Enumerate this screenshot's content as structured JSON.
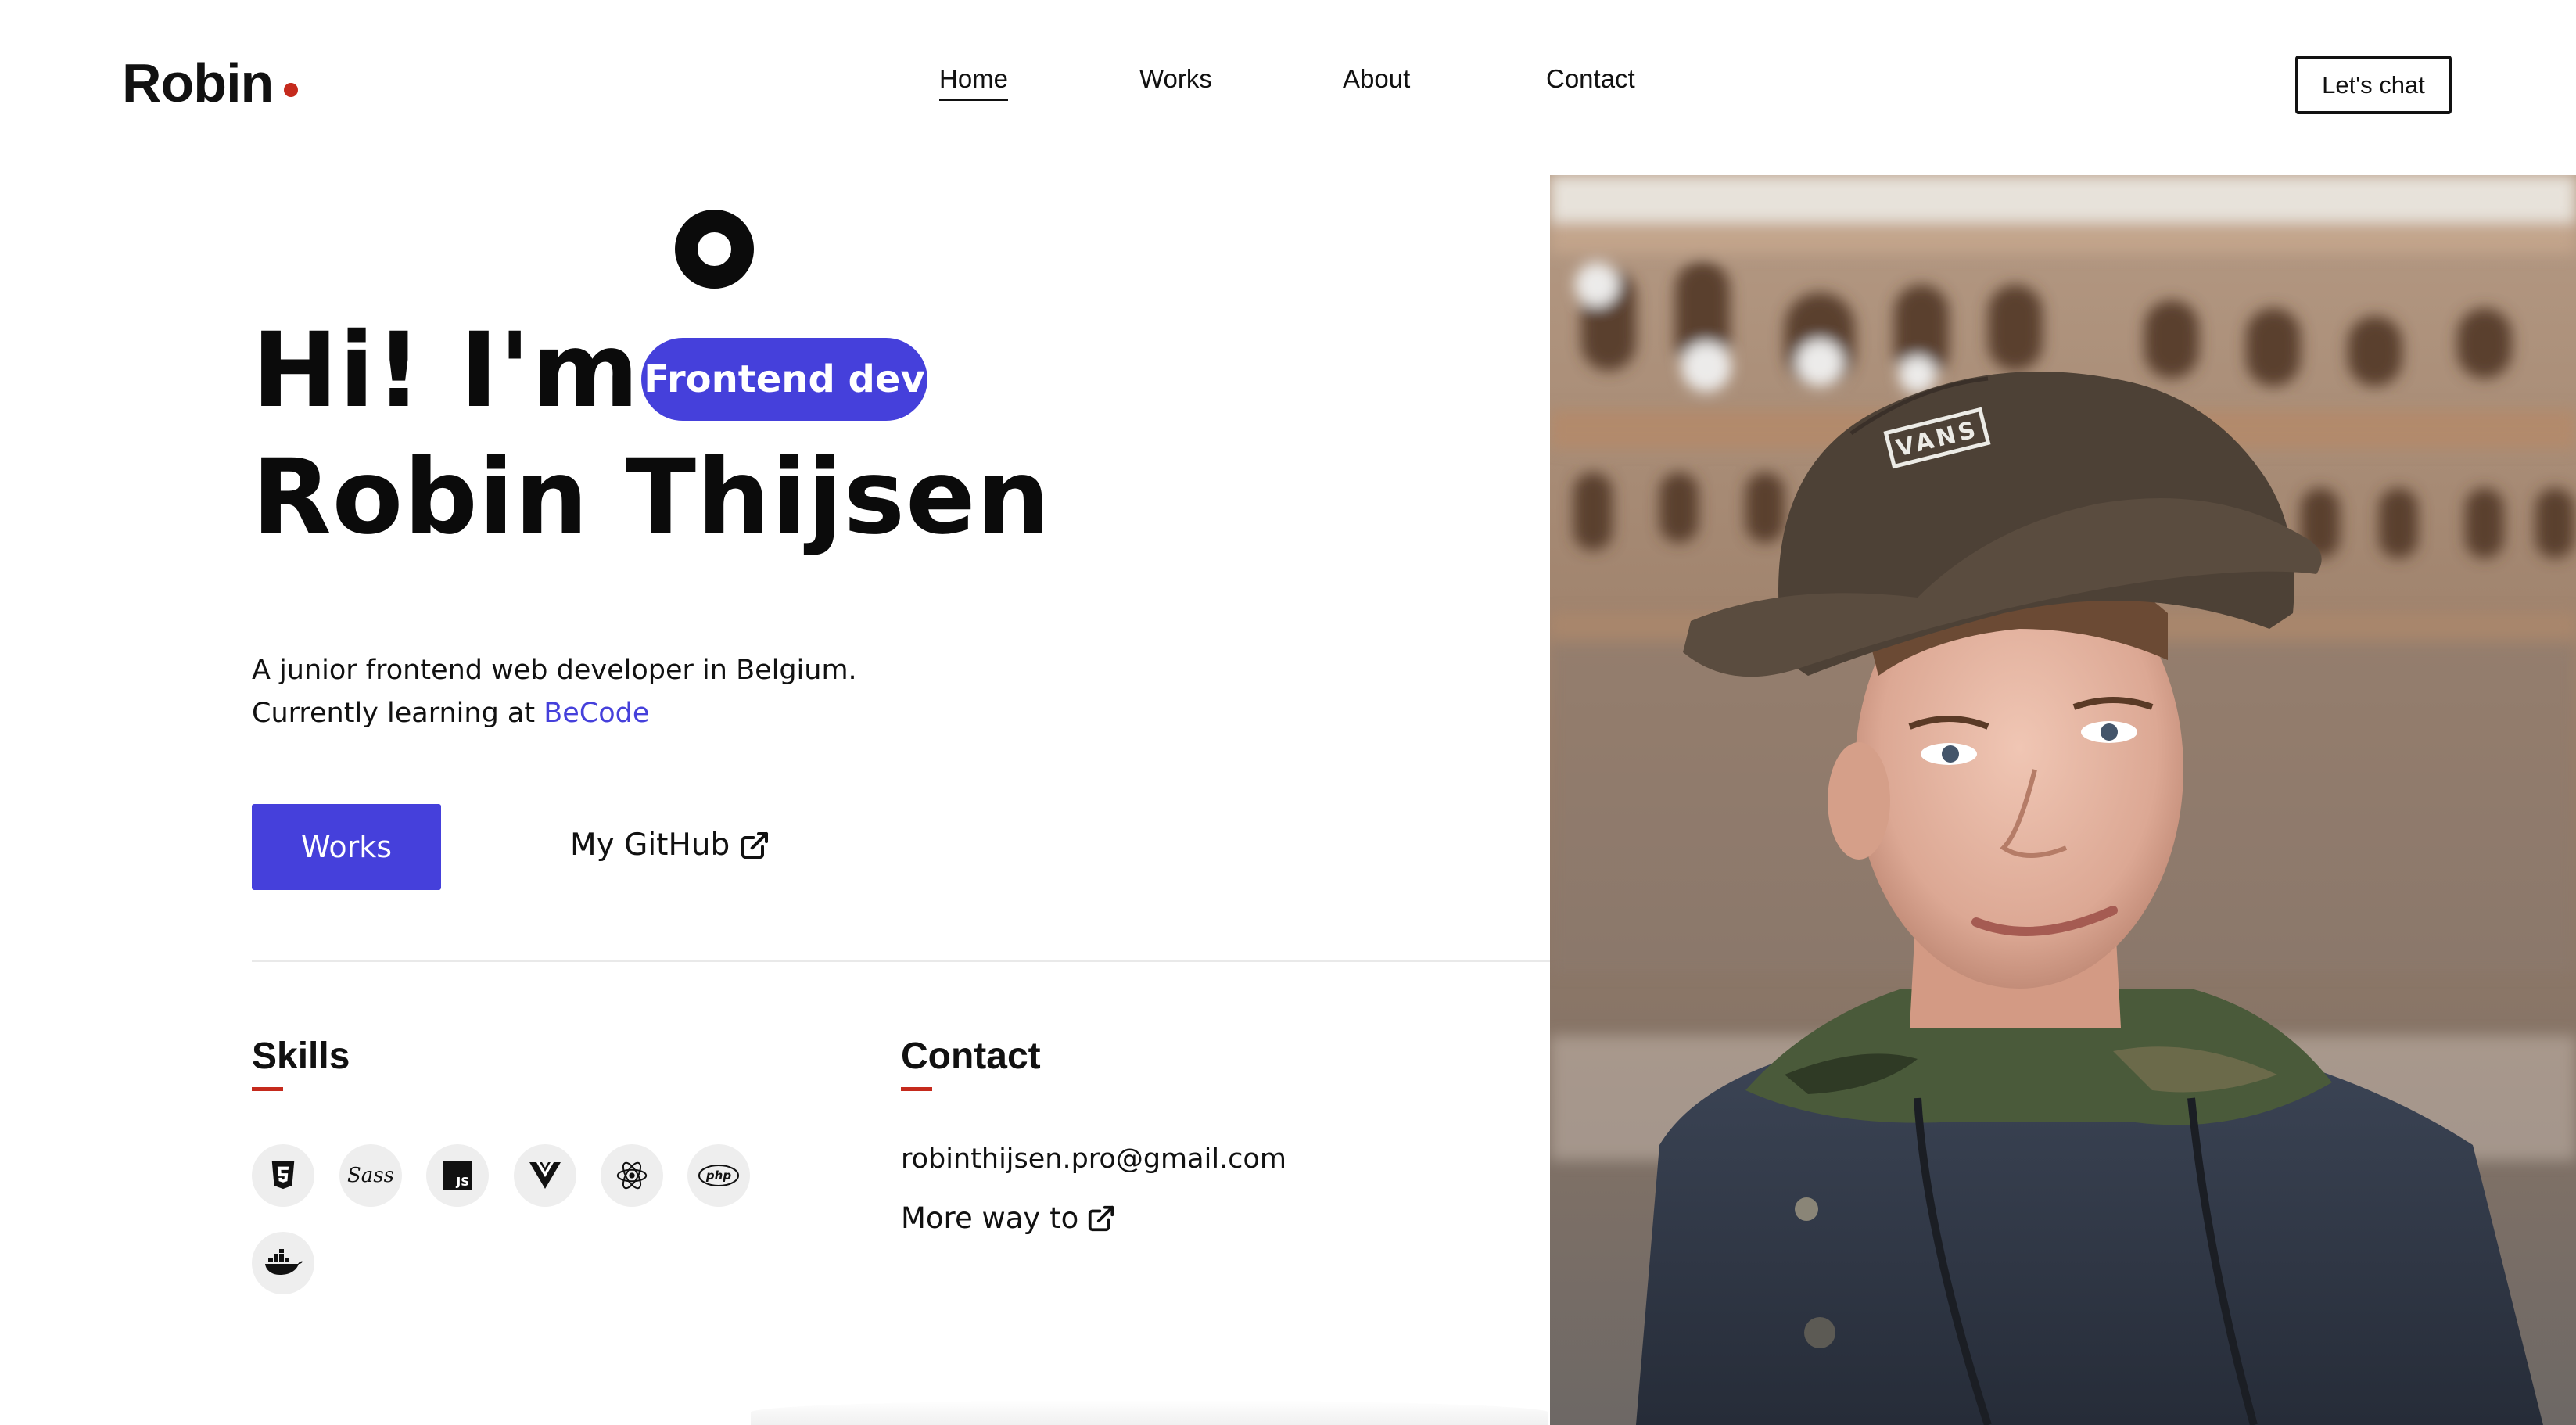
{
  "nav": {
    "logo": "Robin",
    "links": [
      "Home",
      "Works",
      "About",
      "Contact"
    ],
    "cta": "Let's chat"
  },
  "hero": {
    "greeting": "Hi! I'm",
    "badge": "Frontend dev",
    "name": "Robin Thijsen",
    "intro_line1": "A junior frontend web developer in Belgium.",
    "intro_line2_prefix": "Currently learning at ",
    "intro_link": "BeCode",
    "works_button": "Works",
    "github_link": "My GitHub"
  },
  "skills": {
    "title": "Skills",
    "icons": [
      "html5-icon",
      "sass-icon",
      "javascript-icon",
      "vue-icon",
      "react-icon",
      "php-icon",
      "docker-icon"
    ]
  },
  "contact": {
    "title": "Contact",
    "email": "robinthijsen.pro@gmail.com",
    "more_link": "More way to"
  },
  "colors": {
    "accent": "#4540db",
    "logo_dot": "#c52a1d",
    "text": "#111111"
  },
  "photo": {
    "vans_text": "VANS"
  }
}
